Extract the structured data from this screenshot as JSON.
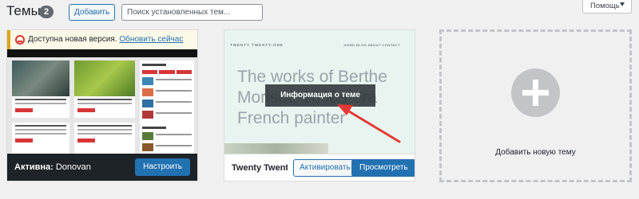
{
  "header": {
    "title": "Темы",
    "count": "2",
    "add_button": "Добавить",
    "search_placeholder": "Поиск установленных тем...",
    "help_tab": "Помощь"
  },
  "themes": [
    {
      "notice_text": "Доступна новая версия.",
      "notice_link": "Обновить сейчас",
      "active_label": "Активна:",
      "name": "Donovan",
      "customize_button": "Настроить"
    },
    {
      "brand": "TWENTY TWENTY-ONE",
      "menu": "HOME   BLOG   ABOUT   CONTACT",
      "headline": "The works of Berthe Morisot, 1800s-era French painter",
      "details_overlay": "Информация о теме",
      "name": "Twenty Twenty-One",
      "activate_button": "Активировать",
      "preview_button": "Просмотреть"
    }
  ],
  "add_new": {
    "label": "Добавить новую тему"
  },
  "colors": {
    "primary": "#2271b1",
    "annotation_arrow": "#e53935"
  }
}
